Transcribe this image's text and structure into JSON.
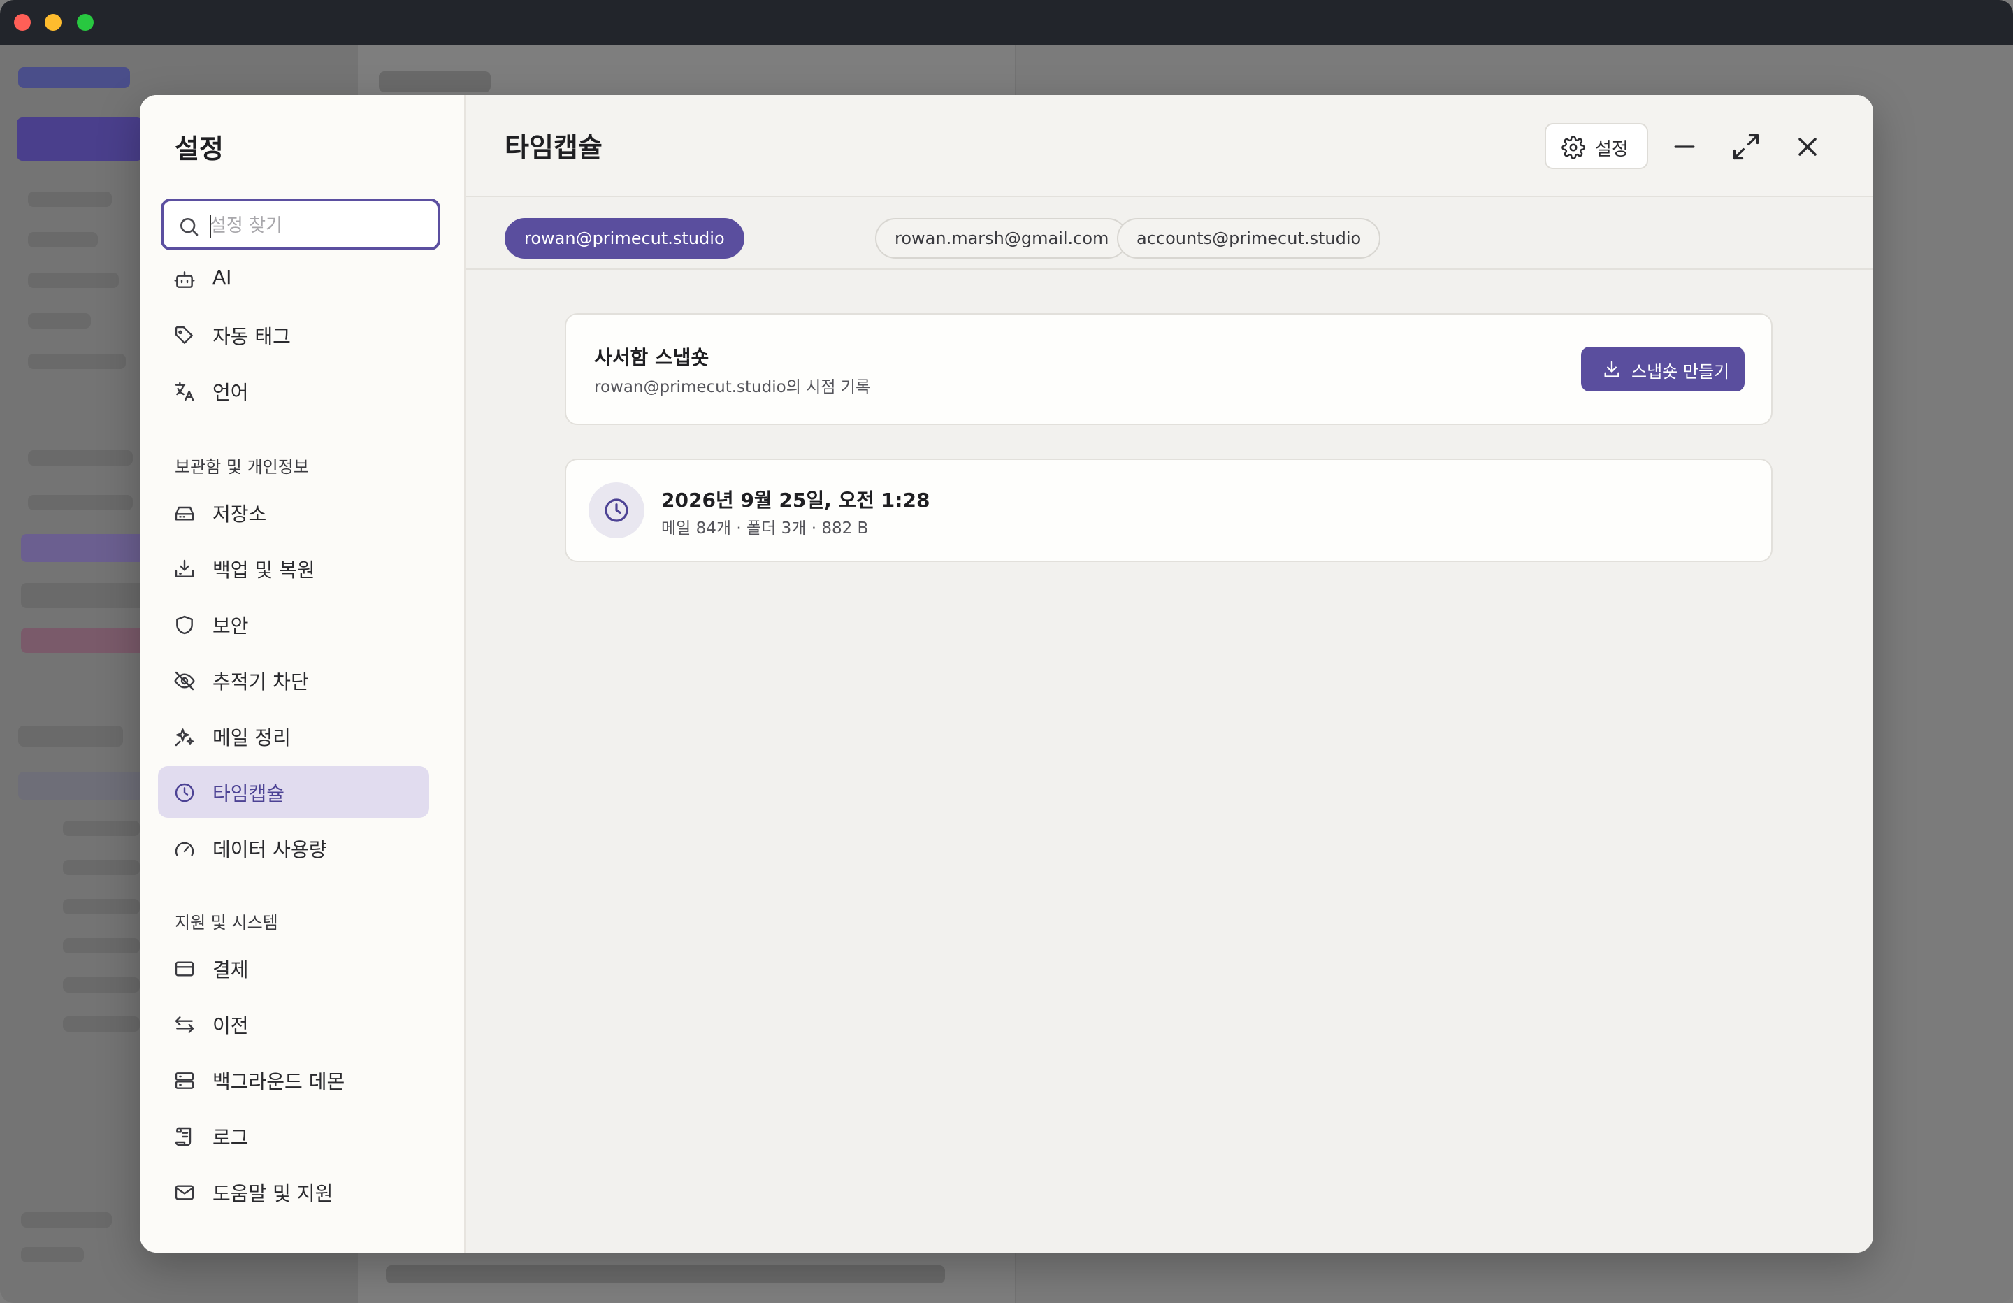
{
  "window": {
    "traffic_lights": [
      "#ff5f57",
      "#febc2e",
      "#28c840"
    ]
  },
  "dialog": {
    "sidebar": {
      "title": "설정",
      "search_placeholder": "설정 찾기",
      "items_top": [
        {
          "label": "AI",
          "icon": "robot-icon"
        },
        {
          "label": "자동 태그",
          "icon": "tag-icon"
        },
        {
          "label": "언어",
          "icon": "translate-icon"
        }
      ],
      "section1": "보관함 및 개인정보",
      "items_section1": [
        {
          "label": "저장소",
          "icon": "hard-drive-icon"
        },
        {
          "label": "백업 및 복원",
          "icon": "download-tray-icon"
        },
        {
          "label": "보안",
          "icon": "shield-icon"
        },
        {
          "label": "추적기 차단",
          "icon": "eye-off-icon"
        },
        {
          "label": "메일 정리",
          "icon": "sparkles-icon"
        },
        {
          "label": "타임캡슐",
          "icon": "clock-icon",
          "active": true
        },
        {
          "label": "데이터 사용량",
          "icon": "gauge-icon"
        }
      ],
      "section2": "지원 및 시스템",
      "items_section2": [
        {
          "label": "결제",
          "icon": "credit-card-icon"
        },
        {
          "label": "이전",
          "icon": "arrows-swap-icon"
        },
        {
          "label": "백그라운드 데몬",
          "icon": "server-icon"
        },
        {
          "label": "로그",
          "icon": "scroll-icon"
        },
        {
          "label": "도움말 및 지원",
          "icon": "mail-icon"
        }
      ]
    },
    "main": {
      "title": "타임캡슐",
      "settings_button": "설정",
      "accounts": [
        {
          "label": "rowan@primecut.studio",
          "active": true
        },
        {
          "label": "rowan.marsh@gmail.com",
          "active": false
        },
        {
          "label": "accounts@primecut.studio",
          "active": false
        }
      ],
      "snapshot_card": {
        "title": "사서함 스냅숏",
        "subtitle": "rowan@primecut.studio의 시점 기록",
        "button": "스냅숏 만들기"
      },
      "snapshots": [
        {
          "date": "2026년 9월 25일, 오전 1:28",
          "meta": "메일 84개 · 폴더 3개 · 882 B"
        }
      ]
    },
    "colors": {
      "accent": "#5a4e9e",
      "active_bg": "#e1dcef"
    }
  }
}
